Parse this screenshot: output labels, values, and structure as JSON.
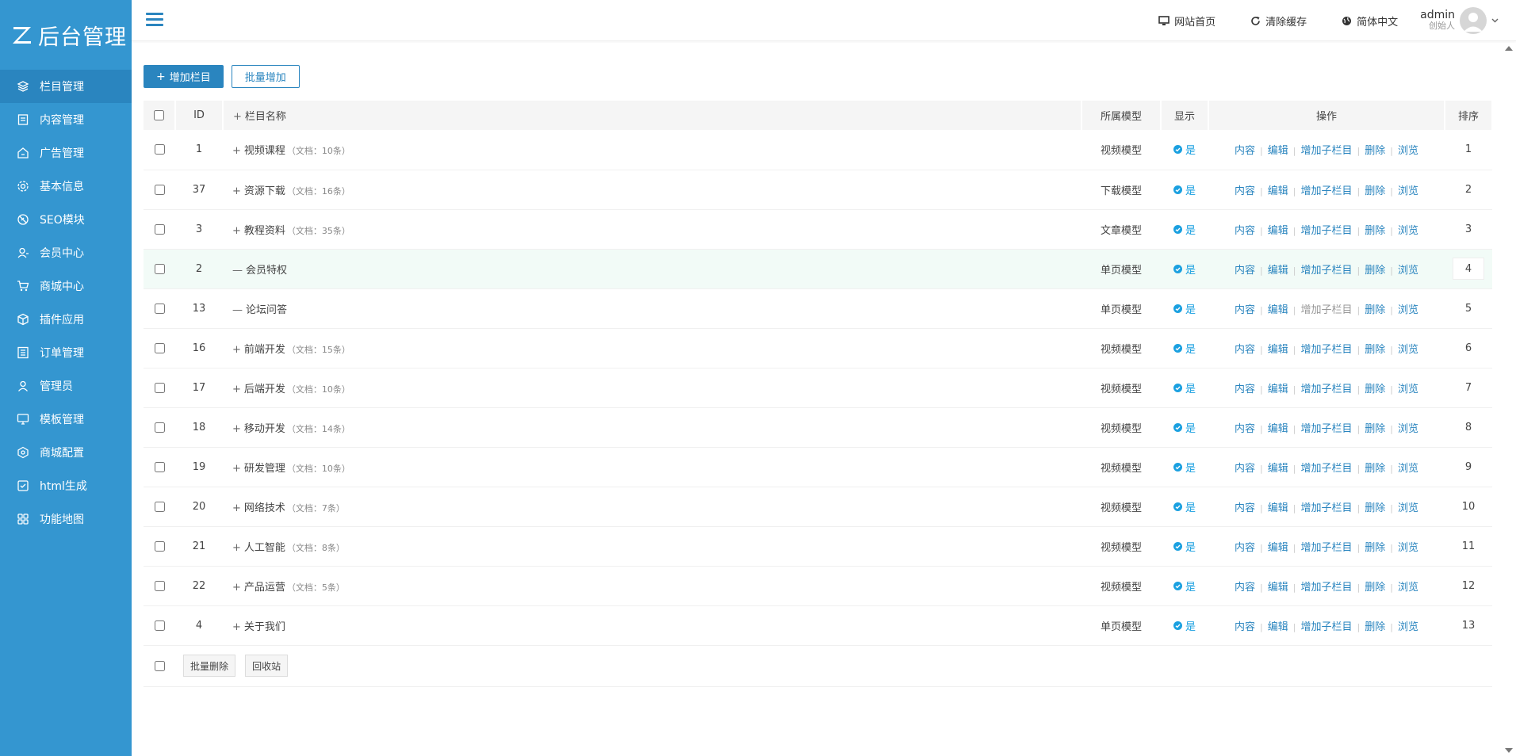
{
  "brand": {
    "logo_text": "后台管理"
  },
  "sidebar": {
    "items": [
      {
        "label": "栏目管理",
        "icon": "layers-icon",
        "active": true
      },
      {
        "label": "内容管理",
        "icon": "document-icon"
      },
      {
        "label": "广告管理",
        "icon": "ad-icon"
      },
      {
        "label": "基本信息",
        "icon": "gear-icon"
      },
      {
        "label": "SEO模块",
        "icon": "seo-icon"
      },
      {
        "label": "会员中心",
        "icon": "user-icon"
      },
      {
        "label": "商城中心",
        "icon": "cart-icon"
      },
      {
        "label": "插件应用",
        "icon": "cube-icon"
      },
      {
        "label": "订单管理",
        "icon": "list-icon"
      },
      {
        "label": "管理员",
        "icon": "admin-icon"
      },
      {
        "label": "模板管理",
        "icon": "monitor-icon"
      },
      {
        "label": "商城配置",
        "icon": "hexagon-icon"
      },
      {
        "label": "html生成",
        "icon": "checkbox-icon"
      },
      {
        "label": "功能地图",
        "icon": "grid-icon"
      }
    ]
  },
  "header": {
    "site_home": "网站首页",
    "clear_cache": "清除缓存",
    "language": "简体中文",
    "user_name": "admin",
    "user_role": "创始人"
  },
  "toolbar": {
    "add_column": "增加栏目",
    "batch_add": "批量增加"
  },
  "table": {
    "headers": {
      "id": "ID",
      "name": "栏目名称",
      "model": "所属模型",
      "show": "显示",
      "ops": "操作",
      "sort": "排序"
    },
    "ops": {
      "content": "内容",
      "edit": "编辑",
      "add_child": "增加子栏目",
      "delete": "删除",
      "browse": "浏览"
    },
    "show_yes": "是",
    "rows": [
      {
        "id": "1",
        "sign": "+",
        "name": "视频课程",
        "doc": "（文档：10条）",
        "model": "视频模型",
        "sort": "1"
      },
      {
        "id": "37",
        "sign": "+",
        "name": "资源下载",
        "doc": "（文档：16条）",
        "model": "下载模型",
        "sort": "2"
      },
      {
        "id": "3",
        "sign": "+",
        "name": "教程资料",
        "doc": "（文档：35条）",
        "model": "文章模型",
        "sort": "3"
      },
      {
        "id": "2",
        "sign": "—",
        "name": "会员特权",
        "doc": "",
        "model": "单页模型",
        "sort": "4",
        "highlight": true
      },
      {
        "id": "13",
        "sign": "—",
        "name": "论坛问答",
        "doc": "",
        "model": "单页模型",
        "sort": "5",
        "add_child_disabled": true
      },
      {
        "id": "16",
        "sign": "+",
        "name": "前端开发",
        "doc": "（文档：15条）",
        "model": "视频模型",
        "sort": "6"
      },
      {
        "id": "17",
        "sign": "+",
        "name": "后端开发",
        "doc": "（文档：10条）",
        "model": "视频模型",
        "sort": "7"
      },
      {
        "id": "18",
        "sign": "+",
        "name": "移动开发",
        "doc": "（文档：14条）",
        "model": "视频模型",
        "sort": "8"
      },
      {
        "id": "19",
        "sign": "+",
        "name": "研发管理",
        "doc": "（文档：10条）",
        "model": "视频模型",
        "sort": "9"
      },
      {
        "id": "20",
        "sign": "+",
        "name": "网络技术",
        "doc": "（文档：7条）",
        "model": "视频模型",
        "sort": "10"
      },
      {
        "id": "21",
        "sign": "+",
        "name": "人工智能",
        "doc": "（文档：8条）",
        "model": "视频模型",
        "sort": "11"
      },
      {
        "id": "22",
        "sign": "+",
        "name": "产品运营",
        "doc": "（文档：5条）",
        "model": "视频模型",
        "sort": "12"
      },
      {
        "id": "4",
        "sign": "+",
        "name": "关于我们",
        "doc": "",
        "model": "单页模型",
        "sort": "13"
      }
    ],
    "footer": {
      "batch_delete": "批量删除",
      "recycle": "回收站"
    }
  },
  "colors": {
    "sidebar_bg": "#3496d0",
    "sidebar_active": "#2a85bf",
    "accent": "#2a85bf",
    "ok": "#1aa0e0"
  }
}
